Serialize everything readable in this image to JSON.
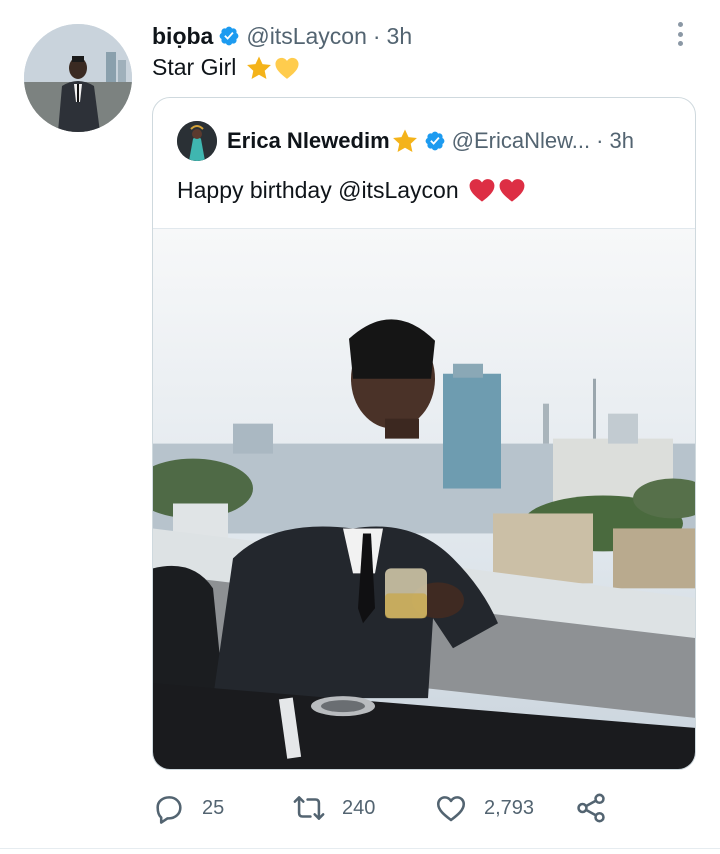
{
  "tweet": {
    "author_name": "biọba",
    "handle": "@itsLaycon",
    "separator": "·",
    "time": "3h",
    "text": "Star Girl"
  },
  "quoted_tweet": {
    "author_name": "Erica Nlewedim",
    "handle": "@EricaNlew...",
    "separator": "·",
    "time": "3h",
    "text": "Happy birthday @itsLaycon"
  },
  "actions": {
    "replies": "25",
    "retweets": "240",
    "likes": "2,793"
  },
  "icons": {
    "verified": "verified-badge-icon",
    "more": "more-vertical-icon",
    "reply": "reply-icon",
    "retweet": "retweet-icon",
    "like": "heart-icon",
    "share": "share-icon"
  },
  "colors": {
    "verified_blue": "#1d9bf0",
    "secondary_text": "#536471",
    "primary_text": "#0f1419",
    "star_yellow": "#f4b31a",
    "heart_yellow": "#ffcc4d",
    "heart_red": "#dd2e44"
  }
}
